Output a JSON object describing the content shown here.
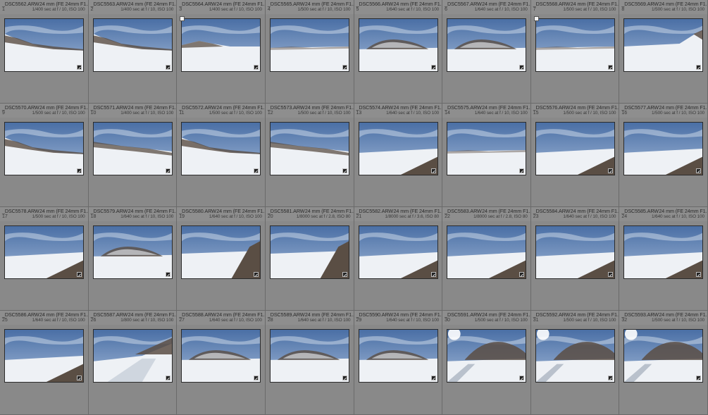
{
  "grid": {
    "columns": 8,
    "cells": [
      {
        "filename": "_DSC5562.ARW",
        "lens": "24 mm (FE 24mm F1...",
        "index": "1",
        "exif": "1/400 sec at f / 10, ISO 100",
        "flagged": false,
        "scene": "hills-left"
      },
      {
        "filename": "_DSC5563.ARW",
        "lens": "24 mm (FE 24mm F1...",
        "index": "2",
        "exif": "1/400 sec at f / 10, ISO 100",
        "flagged": false,
        "scene": "hills-left"
      },
      {
        "filename": "_DSC5564.ARW",
        "lens": "24 mm (FE 24mm F1...",
        "index": "3",
        "exif": "1/400 sec at f / 10, ISO 100",
        "flagged": true,
        "scene": "hills-far"
      },
      {
        "filename": "_DSC5565.ARW",
        "lens": "24 mm (FE 24mm F1...",
        "index": "4",
        "exif": "1/500 sec at f / 10, ISO 100",
        "flagged": false,
        "scene": "plain"
      },
      {
        "filename": "_DSC5566.ARW",
        "lens": "24 mm (FE 24mm F1...",
        "index": "5",
        "exif": "1/640 sec at f / 10, ISO 100",
        "flagged": false,
        "scene": "rocky-hill"
      },
      {
        "filename": "_DSC5567.ARW",
        "lens": "24 mm (FE 24mm F1...",
        "index": "6",
        "exif": "1/640 sec at f / 10, ISO 100",
        "flagged": false,
        "scene": "rocky-hill"
      },
      {
        "filename": "_DSC5568.ARW",
        "lens": "24 mm (FE 24mm F1...",
        "index": "7",
        "exif": "1/500 sec at f / 10, ISO 100",
        "flagged": true,
        "scene": "plain"
      },
      {
        "filename": "_DSC5569.ARW",
        "lens": "24 mm (FE 24mm F1...",
        "index": "8",
        "exif": "1/500 sec at f / 10, ISO 100",
        "flagged": false,
        "scene": "plain-right"
      },
      {
        "filename": "_DSC5570.ARW",
        "lens": "24 mm (FE 24mm F1...",
        "index": "9",
        "exif": "1/500 sec at f / 10, ISO 100",
        "flagged": false,
        "scene": "hills-left"
      },
      {
        "filename": "_DSC5571.ARW",
        "lens": "24 mm (FE 24mm F1...",
        "index": "10",
        "exif": "1/400 sec at f / 10, ISO 100",
        "flagged": false,
        "scene": "ridge"
      },
      {
        "filename": "_DSC5572.ARW",
        "lens": "24 mm (FE 24mm F1...",
        "index": "11",
        "exif": "1/500 sec at f / 10, ISO 100",
        "flagged": false,
        "scene": "hills-left"
      },
      {
        "filename": "_DSC5573.ARW",
        "lens": "24 mm (FE 24mm F1...",
        "index": "12",
        "exif": "1/500 sec at f / 10, ISO 100",
        "flagged": false,
        "scene": "ridge"
      },
      {
        "filename": "_DSC5574.ARW",
        "lens": "24 mm (FE 24mm F1...",
        "index": "13",
        "exif": "1/640 sec at f / 10, ISO 100",
        "flagged": false,
        "scene": "wall"
      },
      {
        "filename": "_DSC5575.ARW",
        "lens": "24 mm (FE 24mm F1...",
        "index": "14",
        "exif": "1/640 sec at f / 10, ISO 100",
        "flagged": false,
        "scene": "plain"
      },
      {
        "filename": "_DSC5576.ARW",
        "lens": "24 mm (FE 24mm F1...",
        "index": "15",
        "exif": "1/500 sec at f / 10, ISO 100",
        "flagged": false,
        "scene": "wall"
      },
      {
        "filename": "_DSC5577.ARW",
        "lens": "24 mm (FE 24mm F1...",
        "index": "16",
        "exif": "1/500 sec at f / 10, ISO 100",
        "flagged": false,
        "scene": "wall"
      },
      {
        "filename": "_DSC5578.ARW",
        "lens": "24 mm (FE 24mm F1...",
        "index": "17",
        "exif": "1/500 sec at f / 10, ISO 100",
        "flagged": false,
        "scene": "wall"
      },
      {
        "filename": "_DSC5579.ARW",
        "lens": "24 mm (FE 24mm F1...",
        "index": "18",
        "exif": "1/640 sec at f / 10, ISO 100",
        "flagged": false,
        "scene": "rocky-hill"
      },
      {
        "filename": "_DSC5580.ARW",
        "lens": "24 mm (FE 24mm F1...",
        "index": "19",
        "exif": "1/640 sec at f / 10, ISO 100",
        "flagged": false,
        "scene": "wall-close"
      },
      {
        "filename": "_DSC5581.ARW",
        "lens": "24 mm (FE 24mm F1...",
        "index": "20",
        "exif": "1/8000 sec at f / 2.8, ISO 80",
        "flagged": false,
        "scene": "wall-close"
      },
      {
        "filename": "_DSC5582.ARW",
        "lens": "24 mm (FE 24mm F1...",
        "index": "21",
        "exif": "1/8000 sec at f / 3.6, ISO 80",
        "flagged": false,
        "scene": "wall"
      },
      {
        "filename": "_DSC5583.ARW",
        "lens": "24 mm (FE 24mm F1...",
        "index": "22",
        "exif": "1/8000 sec at f / 2.8, ISO 80",
        "flagged": false,
        "scene": "wall"
      },
      {
        "filename": "_DSC5584.ARW",
        "lens": "24 mm (FE 24mm F1...",
        "index": "23",
        "exif": "1/640 sec at f / 10, ISO 100",
        "flagged": false,
        "scene": "wall"
      },
      {
        "filename": "_DSC5585.ARW",
        "lens": "24 mm (FE 24mm F1...",
        "index": "24",
        "exif": "1/640 sec at f / 10, ISO 100",
        "flagged": false,
        "scene": "wall"
      },
      {
        "filename": "_DSC5586.ARW",
        "lens": "24 mm (FE 24mm F1...",
        "index": "25",
        "exif": "1/640 sec at f / 10, ISO 100",
        "flagged": false,
        "scene": "wall"
      },
      {
        "filename": "_DSC5587.ARW",
        "lens": "24 mm (FE 24mm F1...",
        "index": "26",
        "exif": "1/800 sec at f / 10, ISO 100",
        "flagged": false,
        "scene": "road"
      },
      {
        "filename": "_DSC5588.ARW",
        "lens": "24 mm (FE 24mm F1...",
        "index": "27",
        "exif": "1/640 sec at f / 10, ISO 100",
        "flagged": false,
        "scene": "rocky-hill"
      },
      {
        "filename": "_DSC5589.ARW",
        "lens": "24 mm (FE 24mm F1...",
        "index": "28",
        "exif": "1/640 sec at f / 10, ISO 100",
        "flagged": false,
        "scene": "rocky-hill"
      },
      {
        "filename": "_DSC5590.ARW",
        "lens": "24 mm (FE 24mm F1...",
        "index": "29",
        "exif": "1/640 sec at f / 10, ISO 100",
        "flagged": false,
        "scene": "rocky-hill"
      },
      {
        "filename": "_DSC5591.ARW",
        "lens": "24 mm (FE 24mm F1...",
        "index": "30",
        "exif": "1/500 sec at f / 10, ISO 100",
        "flagged": false,
        "scene": "sun-hill"
      },
      {
        "filename": "_DSC5592.ARW",
        "lens": "24 mm (FE 24mm F1...",
        "index": "31",
        "exif": "1/500 sec at f / 10, ISO 100",
        "flagged": false,
        "scene": "sun-hill"
      },
      {
        "filename": "_DSC5593.ARW",
        "lens": "24 mm (FE 24mm F1...",
        "index": "32",
        "exif": "1/500 sec at f / 10, ISO 100",
        "flagged": false,
        "scene": "sun-hill"
      }
    ]
  },
  "colors": {
    "cell_bg": "#898989",
    "sky": "#4a6fa5",
    "sky_light": "#9fb6d6",
    "snow": "#eef1f5",
    "rock": "#5a4e44"
  }
}
